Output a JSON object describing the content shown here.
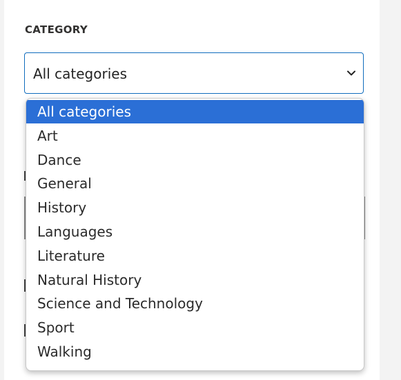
{
  "filter": {
    "label": "CATEGORY",
    "selected_value": "All categories",
    "accent_color": "#0f6cbd"
  },
  "dropdown": {
    "selected_index": 0,
    "highlight_color": "#2b6fd6",
    "options": [
      "All categories",
      "Art",
      "Dance",
      "General",
      "History",
      "Languages",
      "Literature",
      "Natural History",
      "Science and Technology",
      "Sport",
      "Walking"
    ]
  },
  "icons": {
    "select_arrow": "chevron-down-icon"
  }
}
